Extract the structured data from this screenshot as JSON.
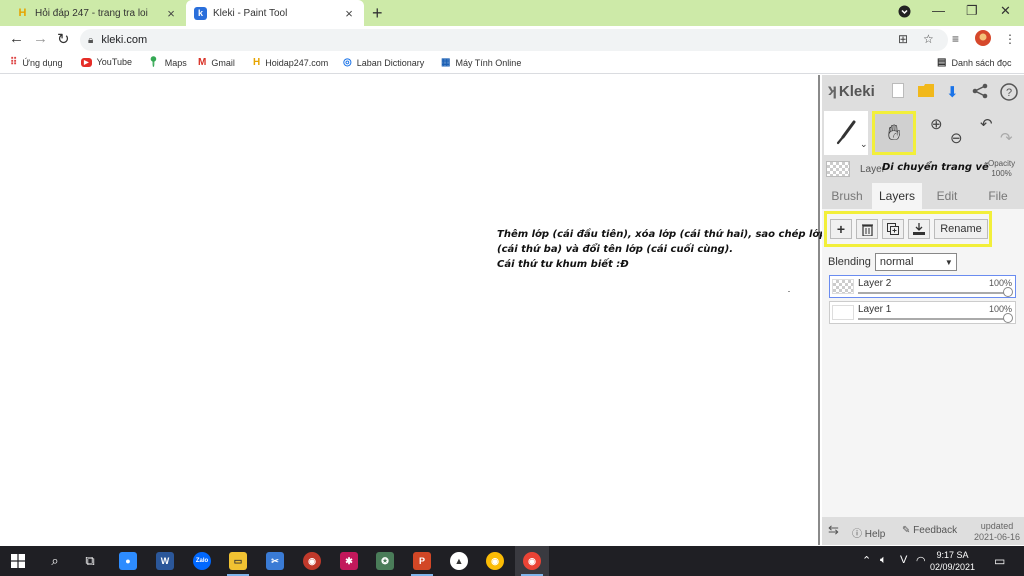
{
  "browser": {
    "tabs": [
      {
        "title": "Hỏi đáp 247 - trang tra loi",
        "icon": "hoidap-favicon"
      },
      {
        "title": "Kleki - Paint Tool",
        "icon": "kleki-favicon",
        "active": true
      }
    ],
    "url": "kleki.com",
    "bookmarks": [
      {
        "label": "Ứng dụng",
        "icon": "apps-grid-icon"
      },
      {
        "label": "YouTube",
        "icon": "youtube-icon"
      },
      {
        "label": "Maps",
        "icon": "maps-pin-icon"
      },
      {
        "label": "Gmail",
        "icon": "gmail-icon"
      },
      {
        "label": "Hoidap247.com",
        "icon": "hoidap-favicon"
      },
      {
        "label": "Laban Dictionary",
        "icon": "laban-icon"
      },
      {
        "label": "Máy Tính Online",
        "icon": "calculator-icon"
      }
    ],
    "reading_list": "Danh sách đọc",
    "colors": {
      "tabstrip": "#cdeaa8",
      "highlight": "#f2ef3a"
    }
  },
  "canvas": {
    "annotation_lines": [
      "Thêm lớp (cái đầu tiên), xóa lớp (cái thứ hai), sao chép lớp",
      "(cái thứ ba) và đổi tên lớp (cái cuối cùng).",
      "Cái thứ tư khum biết :Đ"
    ]
  },
  "kleki": {
    "logo": "Kleki",
    "layer_label": "Layer",
    "hand_hint": "Di chuyển trang vẽ",
    "opacity_label": "Opacity",
    "opacity_value": "100%",
    "tabs": [
      "Brush",
      "Layers",
      "Edit",
      "File"
    ],
    "active_tab": "Layers",
    "rename_label": "Rename",
    "blending_label": "Blending",
    "blending_value": "normal",
    "layers": [
      {
        "name": "Layer 2",
        "opacity": "100%",
        "selected": true
      },
      {
        "name": "Layer 1",
        "opacity": "100%",
        "selected": false
      }
    ],
    "footer": {
      "help": "Help",
      "feedback": "Feedback",
      "updated_label": "updated",
      "updated_date": "2021-06-16"
    }
  },
  "taskbar": {
    "time": "9:17 SA",
    "date": "02/09/2021",
    "lang": "V"
  }
}
